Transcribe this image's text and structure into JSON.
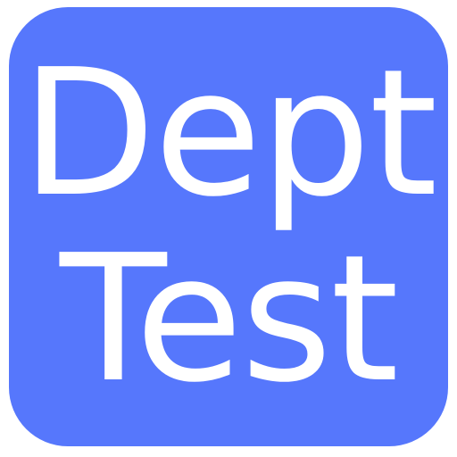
{
  "icon": {
    "line1": "Dept",
    "line2": "Test",
    "background_color": "#5677fc",
    "text_color": "#ffffff"
  }
}
